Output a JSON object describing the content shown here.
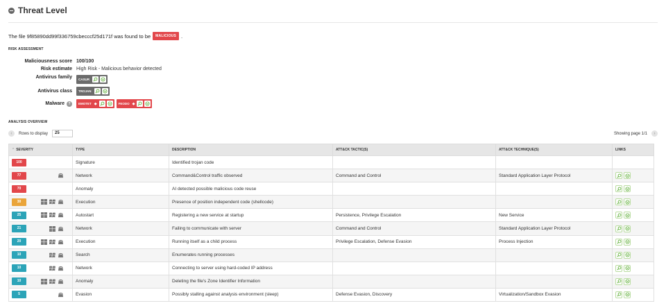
{
  "header": {
    "title": "Threat Level"
  },
  "verdict": {
    "prefix": "The file 9f85890dd99f336759cbecccf25d171f was found to be",
    "badge": "MALICIOUS",
    "suffix": "."
  },
  "risk": {
    "heading": "RISK ASSESSMENT",
    "score_label": "Maliciousness score",
    "score_value": "100/100",
    "estimate_label": "Risk estimate",
    "estimate_value": "High Risk - Malicious behavior detected",
    "family_label": "Antivirus family",
    "family_tags": [
      "CASUR"
    ],
    "class_label": "Antivirus class",
    "class_tags": [
      "TROJAN"
    ],
    "malware_label": "Malware",
    "malware_tags": [
      "EMOTET",
      "FEODO"
    ]
  },
  "analysis": {
    "heading": "ANALYSIS OVERVIEW",
    "rows_label": "Rows to display",
    "rows_value": "25",
    "paging": "Showing page 1/1",
    "columns": {
      "severity": "SEVERITY",
      "type": "TYPE",
      "description": "DESCRIPTION",
      "tactic": "ATT&CK TACTIC(S)",
      "technique": "ATT&CK TECHNIQUE(S)",
      "links": "LINKS"
    },
    "rows": [
      {
        "severity": "100",
        "color": "#e2474b",
        "os": [],
        "type": "Signature",
        "description": "Identified trojan code",
        "tactic": "",
        "technique": "",
        "links": false
      },
      {
        "severity": "77",
        "color": "#e2474b",
        "os": [
          "linux"
        ],
        "type": "Network",
        "description": "Command&Control traffic observed",
        "tactic": "Command and Control",
        "technique": "Standard Application Layer Protocol",
        "links": true
      },
      {
        "severity": "70",
        "color": "#e2474b",
        "os": [],
        "type": "Anomaly",
        "description": "AI detected possible malicious code reuse",
        "tactic": "",
        "technique": "",
        "links": true
      },
      {
        "severity": "30",
        "color": "#eaa53a",
        "os": [
          "win10",
          "win7",
          "linux"
        ],
        "type": "Execution",
        "description": "Presence of position independent code (shellcode)",
        "tactic": "",
        "technique": "",
        "links": true
      },
      {
        "severity": "25",
        "color": "#2ca4b8",
        "os": [
          "win10",
          "win7",
          "linux"
        ],
        "type": "Autostart",
        "description": "Registering a new service at startup",
        "tactic": "Persistence, Privilege Escalation",
        "technique": "New Service",
        "links": true
      },
      {
        "severity": "21",
        "color": "#2ca4b8",
        "os": [
          "win10",
          "linux"
        ],
        "type": "Network",
        "description": "Failing to communicate with server",
        "tactic": "Command and Control",
        "technique": "Standard Application Layer Protocol",
        "links": true
      },
      {
        "severity": "20",
        "color": "#2ca4b8",
        "os": [
          "win10",
          "win7",
          "linux"
        ],
        "type": "Execution",
        "description": "Running itself as a child process",
        "tactic": "Privilege Escalation, Defense Evasion",
        "technique": "Process Injection",
        "links": true
      },
      {
        "severity": "10",
        "color": "#2ca4b8",
        "os": [
          "win7",
          "linux"
        ],
        "type": "Search",
        "description": "Enumerates running processes",
        "tactic": "",
        "technique": "",
        "links": true
      },
      {
        "severity": "10",
        "color": "#2ca4b8",
        "os": [
          "win7",
          "linux"
        ],
        "type": "Network",
        "description": "Connecting to server using hard-coded IP address",
        "tactic": "",
        "technique": "",
        "links": true
      },
      {
        "severity": "10",
        "color": "#2ca4b8",
        "os": [
          "win10",
          "win7",
          "linux"
        ],
        "type": "Anomaly",
        "description": "Deleting the file's Zone Identifier Information",
        "tactic": "",
        "technique": "",
        "links": true
      },
      {
        "severity": "5",
        "color": "#2ca4b8",
        "os": [
          "linux"
        ],
        "type": "Evasion",
        "description": "Possibly stalling against analysis environment (sleep)",
        "tactic": "Defense Evasion, Discovery",
        "technique": "Virtualization/Sandbox Evasion",
        "links": true
      }
    ]
  }
}
